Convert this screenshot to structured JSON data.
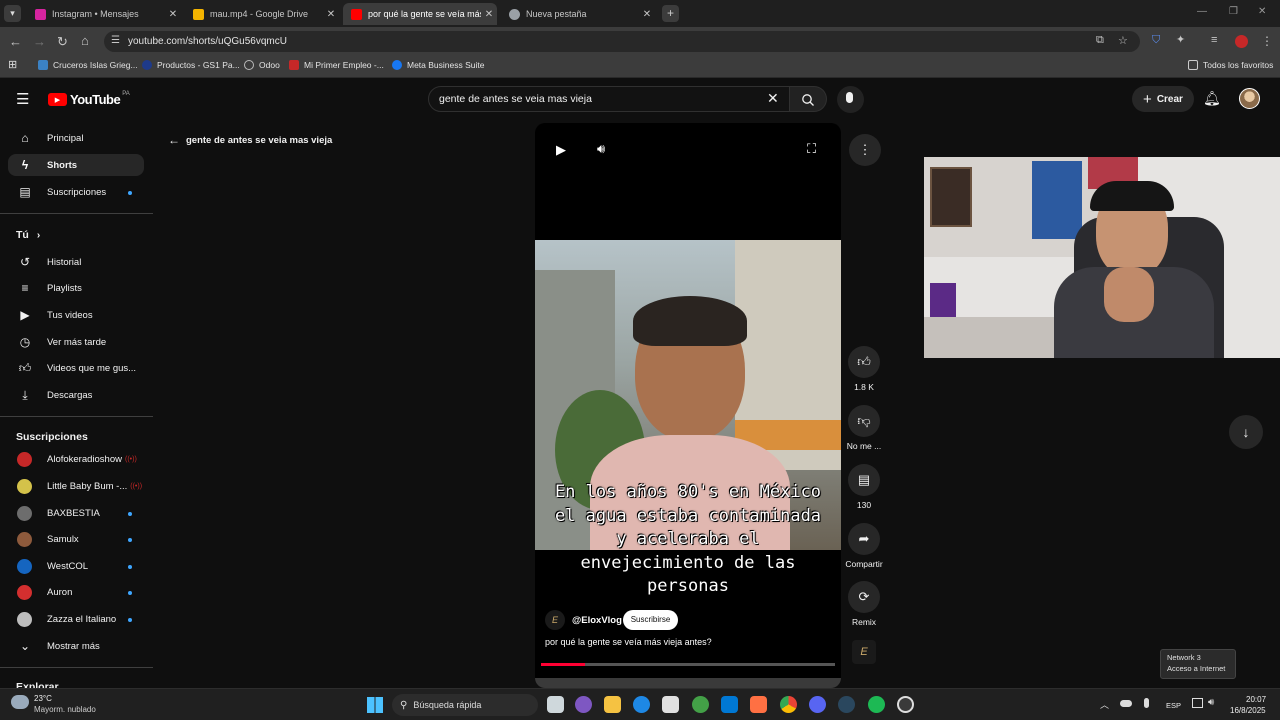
{
  "browser": {
    "tabs": [
      {
        "label": "Instagram • Mensajes",
        "color": "#d6249f"
      },
      {
        "label": "mau.mp4 - Google Drive",
        "color": "#f4b400"
      },
      {
        "label": "por qué la gente se veía más vi",
        "color": "#ff0000"
      },
      {
        "label": "Nueva pestaña",
        "color": "#9aa0a6"
      }
    ],
    "url": "youtube.com/shorts/uQGu56vqmcU",
    "bookmarks": [
      "Cruceros Islas Grieg...",
      "Productos - GS1 Pa...",
      "Odoo",
      "Mi Primer Empleo -...",
      "Meta Business Suite"
    ],
    "all_bookmarks": "Todos los favoritos"
  },
  "youtube": {
    "logo": "YouTube",
    "region": "PA",
    "search_value": "gente de antes se veia mas vieja",
    "create_label": "Crear",
    "back_label": "gente de antes se veia mas vieja",
    "nav": [
      {
        "label": "Principal",
        "icon": "home-icon"
      },
      {
        "label": "Shorts",
        "icon": "shorts-icon"
      },
      {
        "label": "Suscripciones",
        "icon": "subscriptions-icon"
      }
    ],
    "you_label": "Tú",
    "you_items": [
      {
        "label": "Historial",
        "icon": "history-icon"
      },
      {
        "label": "Playlists",
        "icon": "playlists-icon"
      },
      {
        "label": "Tus videos",
        "icon": "your-videos-icon"
      },
      {
        "label": "Ver más tarde",
        "icon": "watch-later-icon"
      },
      {
        "label": "Videos que me gus...",
        "icon": "liked-icon"
      },
      {
        "label": "Descargas",
        "icon": "downloads-icon"
      }
    ],
    "subs_heading": "Suscripciones",
    "subs": [
      {
        "label": "Alofokeradioshow",
        "color": "#c62828",
        "live": true
      },
      {
        "label": "Little Baby Bum -...",
        "color": "#d4c24a",
        "live": true
      },
      {
        "label": "BAXBESTIA",
        "color": "#6d6d6d",
        "live": false
      },
      {
        "label": "Samulx",
        "color": "#8d5a3c",
        "live": false
      },
      {
        "label": "WestCOL",
        "color": "#1565c0",
        "live": false
      },
      {
        "label": "Auron",
        "color": "#d32f2f",
        "live": false
      },
      {
        "label": "Zazza el Italiano",
        "color": "#bdbdbd",
        "live": false
      }
    ],
    "show_more": "Mostrar más",
    "explore": "Explorar",
    "short": {
      "caption": "En los años 80's en México el agua estaba contaminada y aceleraba el envejecimiento de las personas",
      "channel": "@EloxVlog",
      "subscribe": "Suscribirse",
      "title": "por qué la gente se veía más vieja antes?",
      "progress": 0.15,
      "likes": "1.8 K",
      "dislike": "No me ...",
      "comments": "130",
      "share": "Compartir",
      "remix": "Remix"
    }
  },
  "taskbar": {
    "weather_temp": "23°C",
    "weather_desc": "Mayorm. nublado",
    "search": "Búsqueda rápida",
    "lang": "ESP",
    "time": "20:07",
    "date": "16/8/2025",
    "tooltip_title": "Network 3",
    "tooltip_sub": "Acceso a Internet"
  }
}
